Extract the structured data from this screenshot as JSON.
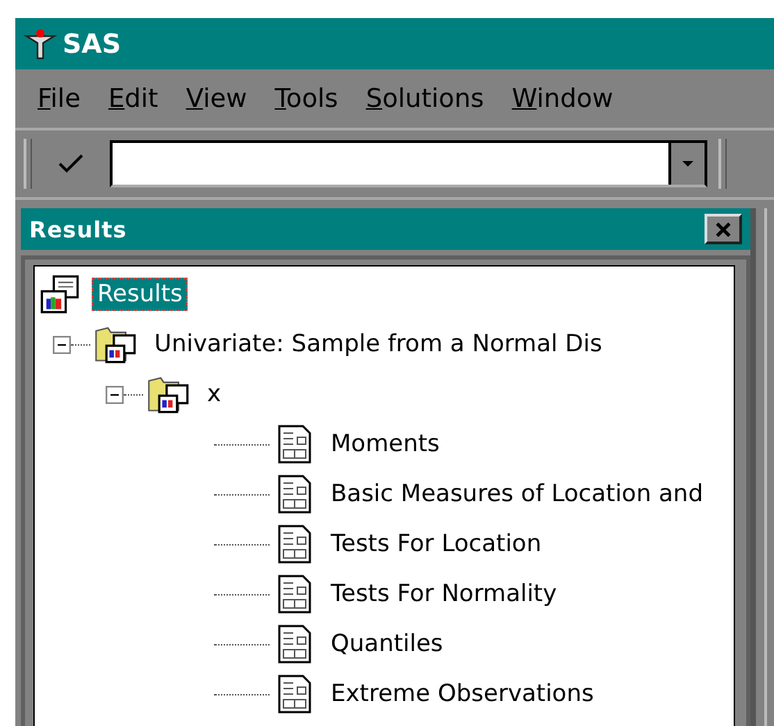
{
  "window": {
    "title": "SAS"
  },
  "menu": [
    "File",
    "Edit",
    "View",
    "Tools",
    "Solutions",
    "Window"
  ],
  "results_panel": {
    "title": "Results",
    "tree": [
      {
        "label": "Results",
        "kind": "results",
        "selected": true,
        "children": [
          {
            "label": "Univariate:  Sample from a Normal Dis",
            "kind": "folder",
            "selected": false,
            "expanded": true,
            "children": [
              {
                "label": "x",
                "kind": "folder",
                "selected": false,
                "expanded": true,
                "children": [
                  {
                    "label": "Moments",
                    "kind": "table",
                    "selected": false
                  },
                  {
                    "label": "Basic Measures of Location and",
                    "kind": "table",
                    "selected": false
                  },
                  {
                    "label": "Tests For Location",
                    "kind": "table",
                    "selected": false
                  },
                  {
                    "label": "Tests For Normality",
                    "kind": "table",
                    "selected": false
                  },
                  {
                    "label": "Quantiles",
                    "kind": "table",
                    "selected": false
                  },
                  {
                    "label": "Extreme Observations",
                    "kind": "table",
                    "selected": false
                  }
                ]
              }
            ]
          }
        ]
      }
    ]
  }
}
